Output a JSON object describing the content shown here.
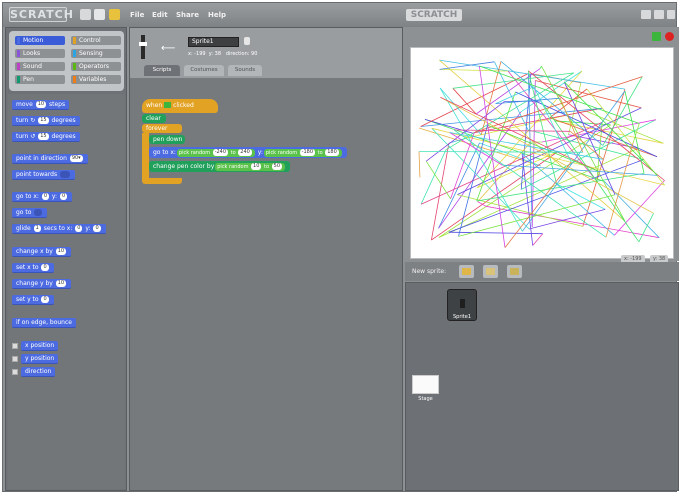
{
  "app": {
    "logo_text": "SCRATCH"
  },
  "menu": [
    "File",
    "Edit",
    "Share",
    "Help"
  ],
  "stage_header": {
    "title": "SCRATCH"
  },
  "categories": [
    {
      "label": "Motion",
      "color": "#4d6be0",
      "active": true
    },
    {
      "label": "Control",
      "color": "#e2a224"
    },
    {
      "label": "Looks",
      "color": "#8a55d7"
    },
    {
      "label": "Sensing",
      "color": "#2ca5e2"
    },
    {
      "label": "Sound",
      "color": "#bb42c3"
    },
    {
      "label": "Operators",
      "color": "#5cb712"
    },
    {
      "label": "Pen",
      "color": "#0e9a6c"
    },
    {
      "label": "Variables",
      "color": "#ee7d16"
    }
  ],
  "palette": {
    "move": "move",
    "move_val": "10",
    "move_unit": "steps",
    "turn_cw": "turn ↻",
    "turn_cw_val": "15",
    "turn_cw_unit": "degrees",
    "turn_ccw": "turn ↺",
    "turn_ccw_val": "15",
    "turn_ccw_unit": "degrees",
    "point_dir": "point in direction",
    "point_dir_val": "90▾",
    "point_towards": "point towards",
    "goto_xy": "go to x:",
    "goto_x": "0",
    "goto_y_label": "y:",
    "goto_y": "0",
    "goto": "go to",
    "glide": "glide",
    "glide_secs": "1",
    "glide_mid": "secs to x:",
    "glide_x": "0",
    "glide_y_label": "y:",
    "glide_y": "0",
    "change_x": "change x by",
    "change_x_val": "10",
    "set_x": "set x to",
    "set_x_val": "0",
    "change_y": "change y by",
    "change_y_val": "10",
    "set_y": "set y to",
    "set_y_val": "0",
    "bounce": "if on edge, bounce",
    "x_position": "x position",
    "y_position": "y position",
    "direction": "direction"
  },
  "sprite": {
    "name": "Sprite1",
    "x_label": "x:",
    "x_val": "-199",
    "y_label": "y:",
    "y_val": "38",
    "direction_label": "direction:",
    "direction_val": "90"
  },
  "tabs": [
    "Scripts",
    "Costumes",
    "Sounds"
  ],
  "script": {
    "when_flag": "when",
    "when_flag_tail": "clicked",
    "clear": "clear",
    "forever": "forever",
    "pen_down": "pen down",
    "goto_x": "go to x:",
    "pick1": "pick random",
    "r1a": "-240",
    "to1": "to",
    "r1b": "240",
    "y_label": "y:",
    "pick2": "pick random",
    "r2a": "-180",
    "to2": "to",
    "r2b": "180",
    "change_pen": "change pen color by",
    "pick3": "pick random",
    "r3a": "10",
    "to3": "to",
    "r3b": "50"
  },
  "stage_status": {
    "left": "x: -199",
    "right": "y: 38"
  },
  "new_sprite_label": "New sprite:",
  "sprites": [
    {
      "label": "Sprite1"
    }
  ],
  "stage_label": "Stage"
}
